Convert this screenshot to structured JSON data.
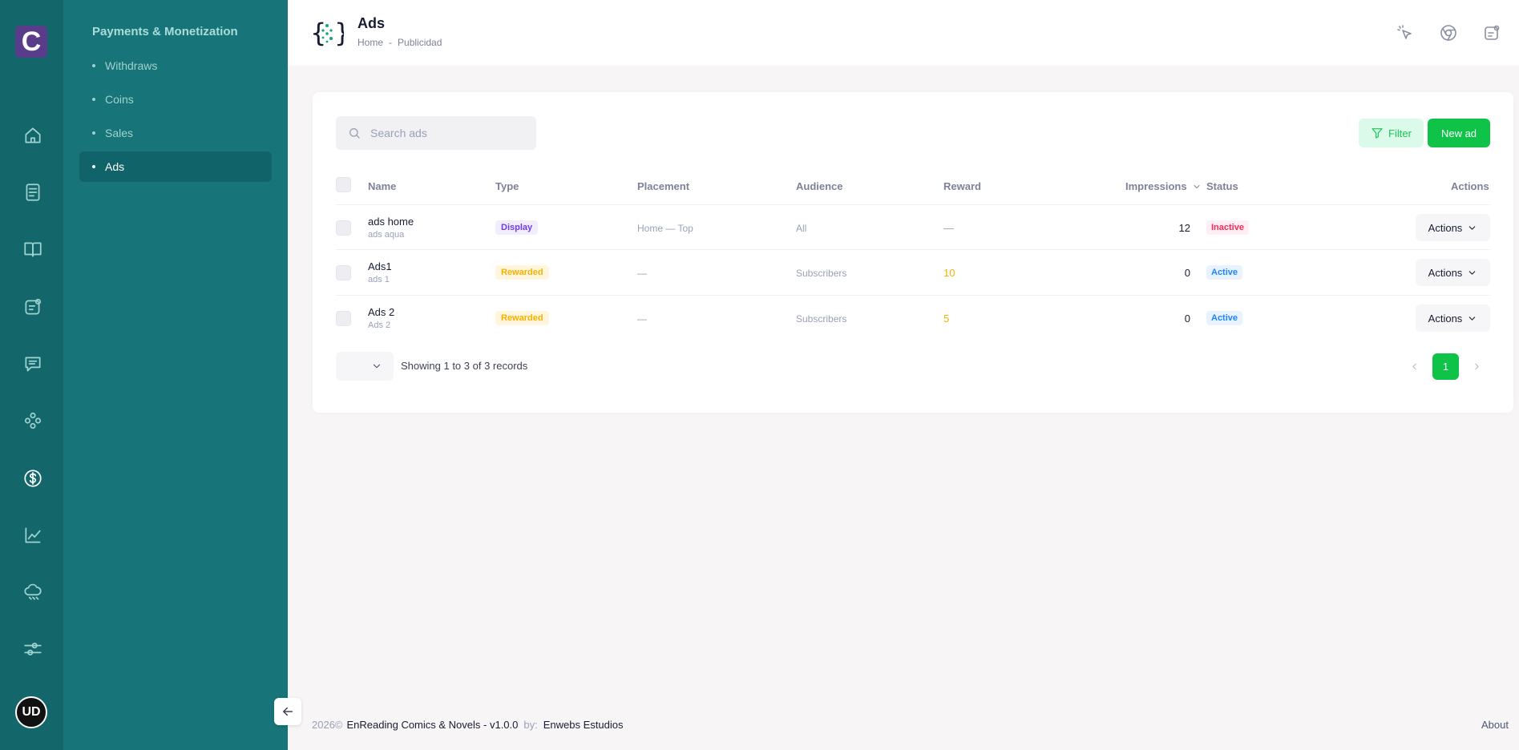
{
  "app": {
    "logo_letter": "C",
    "avatar_text": "UD"
  },
  "subnav": {
    "section_title": "Payments & Monetization",
    "items": [
      {
        "label": "Withdraws",
        "active": false
      },
      {
        "label": "Coins",
        "active": false
      },
      {
        "label": "Sales",
        "active": false
      },
      {
        "label": "Ads",
        "active": true
      }
    ]
  },
  "header": {
    "title": "Ads",
    "breadcrumb": [
      "Home",
      "Publicidad"
    ],
    "breadcrumb_sep": "-"
  },
  "toolbar": {
    "search_placeholder": "Search ads",
    "filter_label": "Filter",
    "new_label": "New ad"
  },
  "table": {
    "columns": {
      "name": "Name",
      "type": "Type",
      "placement": "Placement",
      "audience": "Audience",
      "reward": "Reward",
      "impressions": "Impressions",
      "status": "Status",
      "actions": "Actions"
    },
    "rows": [
      {
        "name": "ads home",
        "subtitle": "ads aqua",
        "type": "Display",
        "placement": "Home — Top",
        "audience": "All",
        "reward": "—",
        "impressions": "12",
        "status": "Inactive",
        "actions_label": "Actions"
      },
      {
        "name": "Ads1",
        "subtitle": "ads 1",
        "type": "Rewarded",
        "placement": "—",
        "audience": "Subscribers",
        "reward": "10",
        "impressions": "0",
        "status": "Active",
        "actions_label": "Actions"
      },
      {
        "name": "Ads 2",
        "subtitle": "Ads 2",
        "type": "Rewarded",
        "placement": "—",
        "audience": "Subscribers",
        "reward": "5",
        "impressions": "0",
        "status": "Active",
        "actions_label": "Actions"
      }
    ]
  },
  "pagination": {
    "records_text": "Showing 1 to 3 of 3 records",
    "current_page": "1"
  },
  "footer": {
    "year": "2026©",
    "product": "EnReading Comics & Novels - v1.0.0",
    "by_label": "by:",
    "company": "Enwebs Estudios",
    "about": "About"
  },
  "colors": {
    "rail": "#13676b",
    "subnav": "#177478",
    "primary_green": "#0ec347",
    "inactive": "#f8285a",
    "active": "#1b84ff",
    "reward": "#f6b100"
  }
}
